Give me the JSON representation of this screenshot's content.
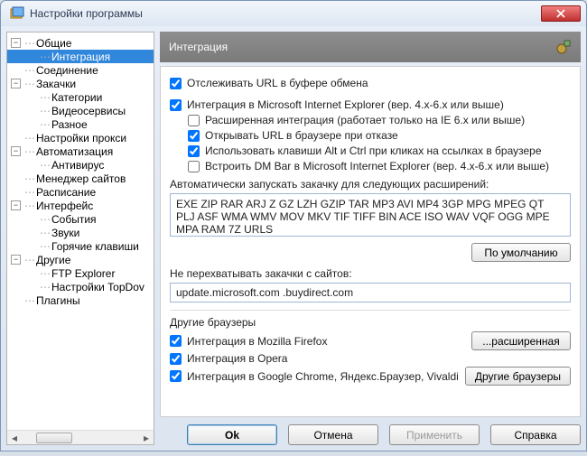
{
  "window": {
    "title": "Настройки программы"
  },
  "tree": {
    "items": [
      {
        "label": "Общие",
        "level": 1,
        "toggle": "−"
      },
      {
        "label": "Интеграция",
        "level": 2,
        "selected": true
      },
      {
        "label": "Соединение",
        "level": 1
      },
      {
        "label": "Закачки",
        "level": 1,
        "toggle": "−"
      },
      {
        "label": "Категории",
        "level": 2
      },
      {
        "label": "Видеосервисы",
        "level": 2
      },
      {
        "label": "Разное",
        "level": 2
      },
      {
        "label": "Настройки прокси",
        "level": 1
      },
      {
        "label": "Автоматизация",
        "level": 1,
        "toggle": "−"
      },
      {
        "label": "Антивирус",
        "level": 2
      },
      {
        "label": "Менеджер сайтов",
        "level": 1
      },
      {
        "label": "Расписание",
        "level": 1
      },
      {
        "label": "Интерфейс",
        "level": 1,
        "toggle": "−"
      },
      {
        "label": "События",
        "level": 2
      },
      {
        "label": "Звуки",
        "level": 2
      },
      {
        "label": "Горячие клавиши",
        "level": 2
      },
      {
        "label": "Другие",
        "level": 1,
        "toggle": "−"
      },
      {
        "label": "FTP Explorer",
        "level": 2
      },
      {
        "label": "Настройки TopDov",
        "level": 2
      },
      {
        "label": "Плагины",
        "level": 1
      }
    ]
  },
  "panel": {
    "title": "Интеграция",
    "monitor_clipboard": {
      "label": "Отслеживать URL в буфере обмена",
      "checked": true
    },
    "ie_integration": {
      "label": "Интеграция в Microsoft Internet Explorer (вер. 4.x-6.x или выше)",
      "checked": true
    },
    "ie_sub": [
      {
        "label": "Расширенная интеграция (работает только на IE 6.x или выше)",
        "checked": false
      },
      {
        "label": "Открывать URL в браузере при отказе",
        "checked": true
      },
      {
        "label": "Использовать клавиши Alt и Ctrl при кликах на ссылках в браузере",
        "checked": true
      },
      {
        "label": "Встроить DM Bar в Microsoft Internet Explorer (вер. 4.x-6.x или выше)",
        "checked": false
      }
    ],
    "auto_extensions_label": "Автоматически запускать закачку для следующих расширений:",
    "auto_extensions_value": "EXE ZIP RAR ARJ Z GZ LZH GZIP TAR MP3 AVI MP4 3GP MPG MPEG QT PLJ ASF WMA WMV MOV MKV TIF TIFF BIN ACE ISO WAV VQF OGG MPE MPA RAM 7Z URLS",
    "default_btn": "По умолчанию",
    "skip_sites_label": "Не перехватывать закачки с сайтов:",
    "skip_sites_value": "update.microsoft.com .buydirect.com",
    "other_browsers_header": "Другие браузеры",
    "browsers": [
      {
        "label": "Интеграция в Mozilla Firefox",
        "checked": true,
        "btn": "...расширенная"
      },
      {
        "label": "Интеграция в Opera",
        "checked": true,
        "btn": null
      },
      {
        "label": "Интеграция в Google Chrome, Яндекс.Браузер, Vivaldi",
        "checked": true,
        "btn": "Другие браузеры"
      }
    ]
  },
  "footer": {
    "ok": "Ok",
    "cancel": "Отмена",
    "apply": "Применить",
    "help": "Справка"
  }
}
